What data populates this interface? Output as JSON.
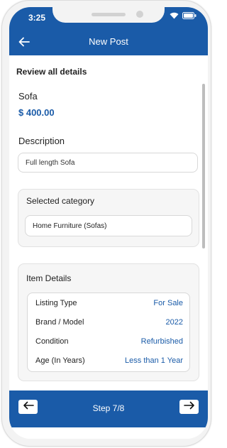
{
  "status": {
    "time": "3:25"
  },
  "header": {
    "title": "New Post"
  },
  "review": {
    "heading": "Review all details"
  },
  "item": {
    "name": "Sofa",
    "price": "$ 400.00"
  },
  "description": {
    "label": "Description",
    "value": "Full length Sofa"
  },
  "category": {
    "label": "Selected category",
    "value": "Home Furniture (Sofas)"
  },
  "details": {
    "label": "Item Details",
    "rows": [
      {
        "key": "Listing Type",
        "value": "For Sale"
      },
      {
        "key": "Brand / Model",
        "value": "2022"
      },
      {
        "key": "Condition",
        "value": "Refurbished"
      },
      {
        "key": "Age (In Years)",
        "value": "Less than 1 Year"
      }
    ]
  },
  "footer": {
    "step": "Step 7/8"
  },
  "icons": {
    "back": "arrow-left-icon",
    "prev": "arrow-left-icon",
    "next": "arrow-right-icon",
    "wifi": "wifi-icon",
    "battery": "battery-icon"
  },
  "colors": {
    "primary": "#1a5ba8",
    "accent_text": "#1a5ba8"
  }
}
